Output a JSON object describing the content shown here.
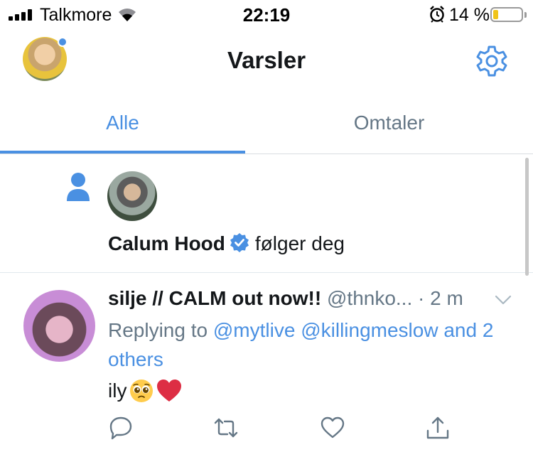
{
  "status_bar": {
    "carrier": "Talkmore",
    "time": "22:19",
    "battery_percent": "14 %",
    "battery_level": 0.14,
    "battery_color": "#f0c419"
  },
  "header": {
    "title": "Varsler",
    "settings_icon": "gear-icon"
  },
  "tabs": [
    {
      "label": "Alle",
      "active": true
    },
    {
      "label": "Omtaler",
      "active": false
    }
  ],
  "follow_notification": {
    "icon": "person-icon",
    "name": "Calum Hood",
    "verified": true,
    "action_text": "følger deg"
  },
  "tweet": {
    "display_name": "silje // CALM out now!!",
    "handle": "@thnko...",
    "time": "· 2 m",
    "replying_to_label": "Replying to",
    "mentions": [
      "@mytlive",
      "@killingmeslow"
    ],
    "and_label": "and",
    "others": "2 others",
    "text": "ily",
    "emojis": [
      "pleading-face",
      "red-heart"
    ],
    "actions": [
      "reply-icon",
      "retweet-icon",
      "like-icon",
      "share-icon"
    ]
  },
  "colors": {
    "accent": "#4a90e2",
    "secondary_text": "#657786",
    "primary_text": "#14171a"
  }
}
